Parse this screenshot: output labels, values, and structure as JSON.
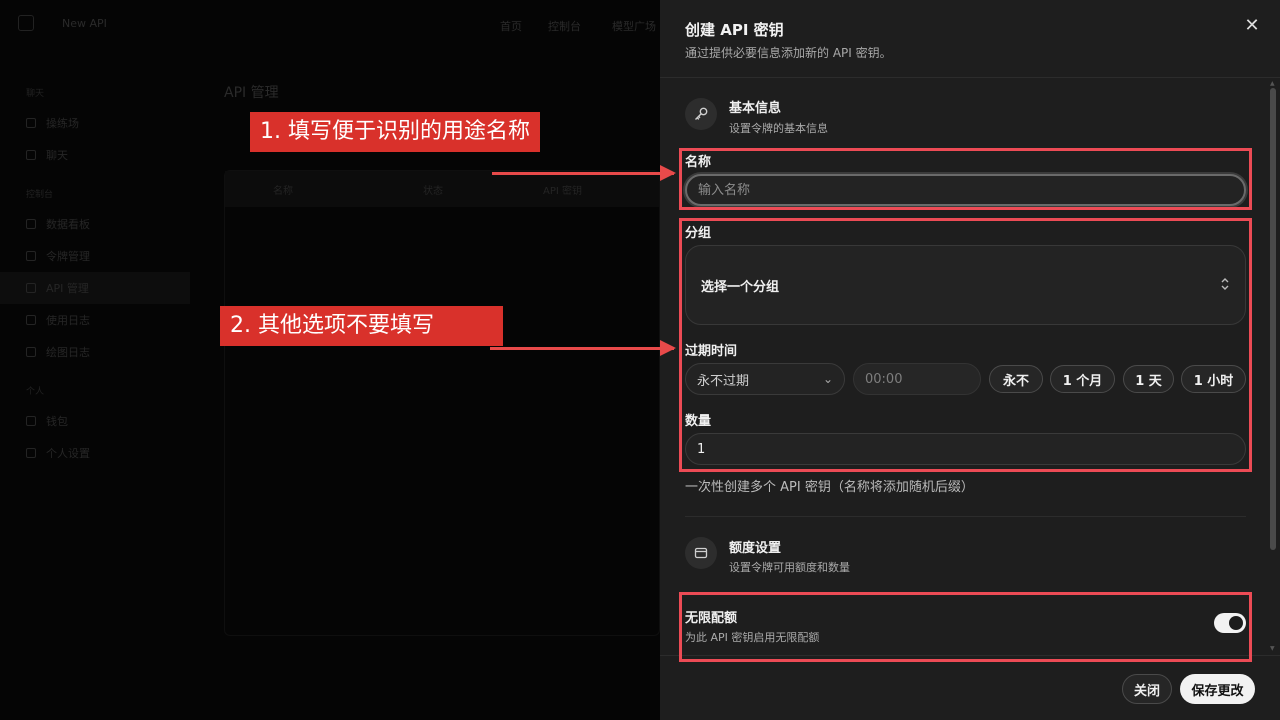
{
  "background": {
    "logo": "New API",
    "nav": [
      "首页",
      "控制台",
      "模型广场"
    ],
    "sidebar_sections": [
      "聊天",
      "控制台",
      "个人"
    ],
    "sidebar_items": [
      "操练场",
      "聊天",
      "数据看板",
      "令牌管理",
      "API 管理",
      "使用日志",
      "绘图日志",
      "钱包",
      "个人设置"
    ],
    "page_title": "API 管理",
    "table_headers": [
      "名称",
      "状态",
      "API 密钥"
    ]
  },
  "annotations": {
    "callout_1": "1. 填写便于识别的用途名称",
    "callout_2": "2. 其他选项不要填写"
  },
  "drawer": {
    "title": "创建 API 密钥",
    "subtitle": "通过提供必要信息添加新的 API 密钥。",
    "close_glyph": "✕",
    "basic": {
      "title": "基本信息",
      "subtitle": "设置令牌的基本信息"
    },
    "name": {
      "label": "名称",
      "placeholder": "输入名称"
    },
    "group": {
      "label": "分组",
      "placeholder": "选择一个分组"
    },
    "expiry": {
      "label": "过期时间",
      "dropdown_value": "永不过期",
      "time_placeholder": "00:00",
      "presets": [
        "永不",
        "1 个月",
        "1 天",
        "1 小时"
      ]
    },
    "quantity": {
      "label": "数量",
      "value": "1",
      "helper": "一次性创建多个 API 密钥（名称将添加随机后缀）"
    },
    "quota": {
      "title": "额度设置",
      "subtitle": "设置令牌可用额度和数量"
    },
    "unlimited": {
      "label": "无限配额",
      "description": "为此 API 密钥启用无限配额",
      "enabled": true
    },
    "footer": {
      "close_label": "关闭",
      "save_label": "保存更改"
    }
  },
  "colors": {
    "annotation_red": "#d9312b",
    "box_red": "#ec4b55",
    "drawer_bg": "#1e1e1e"
  }
}
